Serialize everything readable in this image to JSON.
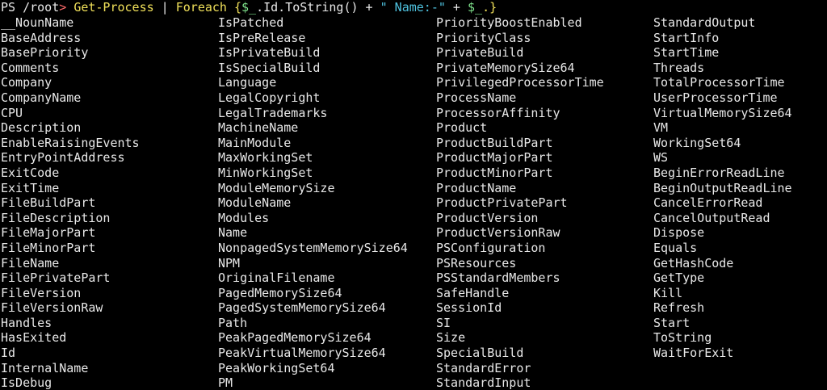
{
  "prompt": {
    "ps": "PS /root",
    "arrow": ">",
    "cmd": "Get-Process",
    "pipe": " | ",
    "foreach": "Foreach",
    "open": " {",
    "var1": "$_",
    "member": ".Id.ToString() + ",
    "str": "\" Name:-\"",
    "plus": " + ",
    "var2": "$_",
    "close": ".}"
  },
  "columns": [
    [
      "__NounName",
      "BaseAddress",
      "BasePriority",
      "Comments",
      "Company",
      "CompanyName",
      "CPU",
      "Description",
      "EnableRaisingEvents",
      "EntryPointAddress",
      "ExitCode",
      "ExitTime",
      "FileBuildPart",
      "FileDescription",
      "FileMajorPart",
      "FileMinorPart",
      "FileName",
      "FilePrivatePart",
      "FileVersion",
      "FileVersionRaw",
      "Handles",
      "HasExited",
      "Id",
      "InternalName",
      "IsDebug"
    ],
    [
      "IsPatched",
      "IsPreRelease",
      "IsPrivateBuild",
      "IsSpecialBuild",
      "Language",
      "LegalCopyright",
      "LegalTrademarks",
      "MachineName",
      "MainModule",
      "MaxWorkingSet",
      "MinWorkingSet",
      "ModuleMemorySize",
      "ModuleName",
      "Modules",
      "Name",
      "NonpagedSystemMemorySize64",
      "NPM",
      "OriginalFilename",
      "PagedMemorySize64",
      "PagedSystemMemorySize64",
      "Path",
      "PeakPagedMemorySize64",
      "PeakVirtualMemorySize64",
      "PeakWorkingSet64",
      "PM"
    ],
    [
      "PriorityBoostEnabled",
      "PriorityClass",
      "PrivateBuild",
      "PrivateMemorySize64",
      "PrivilegedProcessorTime",
      "ProcessName",
      "ProcessorAffinity",
      "Product",
      "ProductBuildPart",
      "ProductMajorPart",
      "ProductMinorPart",
      "ProductName",
      "ProductPrivatePart",
      "ProductVersion",
      "ProductVersionRaw",
      "PSConfiguration",
      "PSResources",
      "PSStandardMembers",
      "SafeHandle",
      "SessionId",
      "SI",
      "Size",
      "SpecialBuild",
      "StandardError",
      "StandardInput"
    ],
    [
      "StandardOutput",
      "StartInfo",
      "StartTime",
      "Threads",
      "TotalProcessorTime",
      "UserProcessorTime",
      "VirtualMemorySize64",
      "VM",
      "WorkingSet64",
      "WS",
      "BeginErrorReadLine",
      "BeginOutputReadLine",
      "CancelErrorRead",
      "CancelOutputRead",
      "Dispose",
      "Equals",
      "GetHashCode",
      "GetType",
      "Kill",
      "Refresh",
      "Start",
      "ToString",
      "WaitForExit"
    ]
  ]
}
